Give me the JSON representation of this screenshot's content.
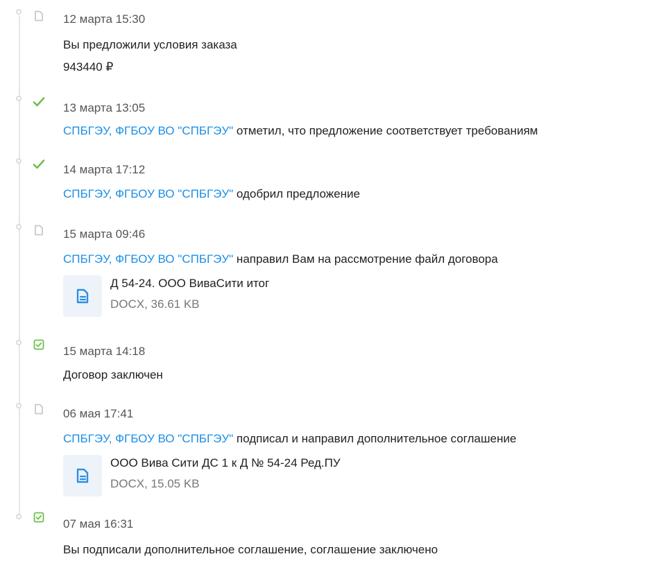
{
  "events": [
    {
      "icon": "document-icon",
      "date": "12 марта 15:30",
      "text": "Вы предложили условия заказа",
      "amount": "943440 ₽"
    },
    {
      "icon": "checkmark-icon",
      "date": "13 марта 13:05",
      "org": "СПБГЭУ, ФГБОУ ВО \"СПБГЭУ\"",
      "text": " отметил, что предложение соответствует требованиям"
    },
    {
      "icon": "checkmark-icon",
      "date": "14 марта 17:12",
      "org": "СПБГЭУ, ФГБОУ ВО \"СПБГЭУ\"",
      "text": " одобрил предложение"
    },
    {
      "icon": "document-icon",
      "date": "15 марта 09:46",
      "org": "СПБГЭУ, ФГБОУ ВО \"СПБГЭУ\"",
      "text": " направил Вам на рассмотрение файл договора",
      "file": {
        "name": "Д 54-24. ООО ВиваСити итог",
        "meta": "DOCX, 36.61 KB"
      }
    },
    {
      "icon": "document-check-icon",
      "date": "15 марта 14:18",
      "text": "Договор заключен"
    },
    {
      "icon": "document-icon",
      "date": "06 мая 17:41",
      "org": "СПБГЭУ, ФГБОУ ВО \"СПБГЭУ\"",
      "text": " подписал и направил дополнительное соглашение",
      "file": {
        "name": "ООО Вива Сити ДС 1 к Д № 54-24 Ред.ПУ",
        "meta": "DOCX, 15.05 KB"
      }
    },
    {
      "icon": "document-check-icon",
      "date": "07 мая 16:31",
      "text": "Вы подписали дополнительное соглашение, соглашение заключено"
    }
  ],
  "colors": {
    "link": "#1b8fe6",
    "check": "#6cc04a",
    "doc_icon": "#c8c8c8",
    "file_icon": "#2d8fe0"
  }
}
